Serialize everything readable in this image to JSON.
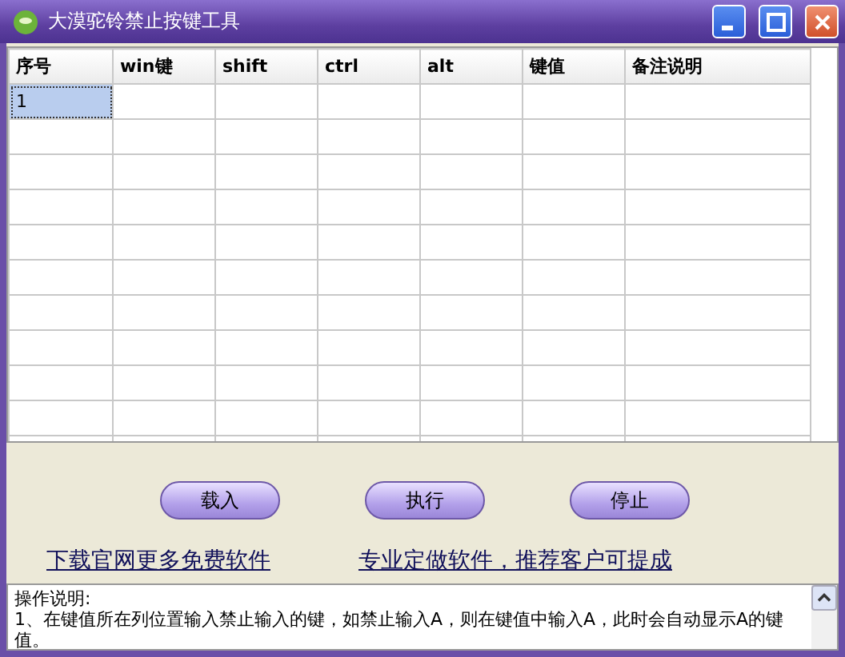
{
  "window": {
    "title": "大漠驼铃禁止按键工具"
  },
  "table": {
    "columns": [
      "序号",
      "win键",
      "shift",
      "ctrl",
      "alt",
      "键值",
      "备注说明"
    ],
    "rows": [
      {
        "cells": [
          "1"
        ],
        "selected": true
      }
    ]
  },
  "buttons": [
    "载入",
    "执行",
    "停止"
  ],
  "links": [
    "下载官网更多免费软件",
    "专业定做软件，推荐客户可提成"
  ],
  "instructions": {
    "lines": [
      "操作说明:",
      "1、在键值所在列位置输入禁止输入的键，如禁止输入A，则在键值中输入A，此时会自动显示A的键值。"
    ]
  }
}
